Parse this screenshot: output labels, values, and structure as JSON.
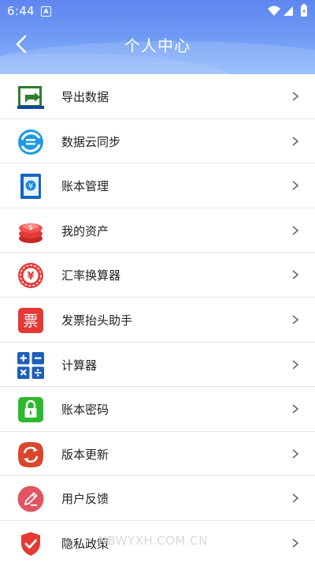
{
  "status_bar": {
    "time": "6:44",
    "notif_letter": "A"
  },
  "header": {
    "title": "个人中心"
  },
  "menu": [
    {
      "label": "导出数据",
      "icon": "export-icon"
    },
    {
      "label": "数据云同步",
      "icon": "cloud-sync-icon"
    },
    {
      "label": "账本管理",
      "icon": "ledger-icon"
    },
    {
      "label": "我的资产",
      "icon": "assets-icon"
    },
    {
      "label": "汇率换算器",
      "icon": "exchange-rate-icon"
    },
    {
      "label": "发票抬头助手",
      "icon": "invoice-icon"
    },
    {
      "label": "计算器",
      "icon": "calculator-icon"
    },
    {
      "label": "账本密码",
      "icon": "lock-icon"
    },
    {
      "label": "版本更新",
      "icon": "update-icon"
    },
    {
      "label": "用户反馈",
      "icon": "feedback-icon"
    },
    {
      "label": "隐私政策",
      "icon": "privacy-shield-icon"
    }
  ],
  "invoice_glyph": "票",
  "watermark": "• NBWYXH.COM.CN",
  "colors": {
    "header_top": "#5f86f0",
    "header_bottom": "#8db7fb",
    "divider": "#e6e6e6"
  }
}
